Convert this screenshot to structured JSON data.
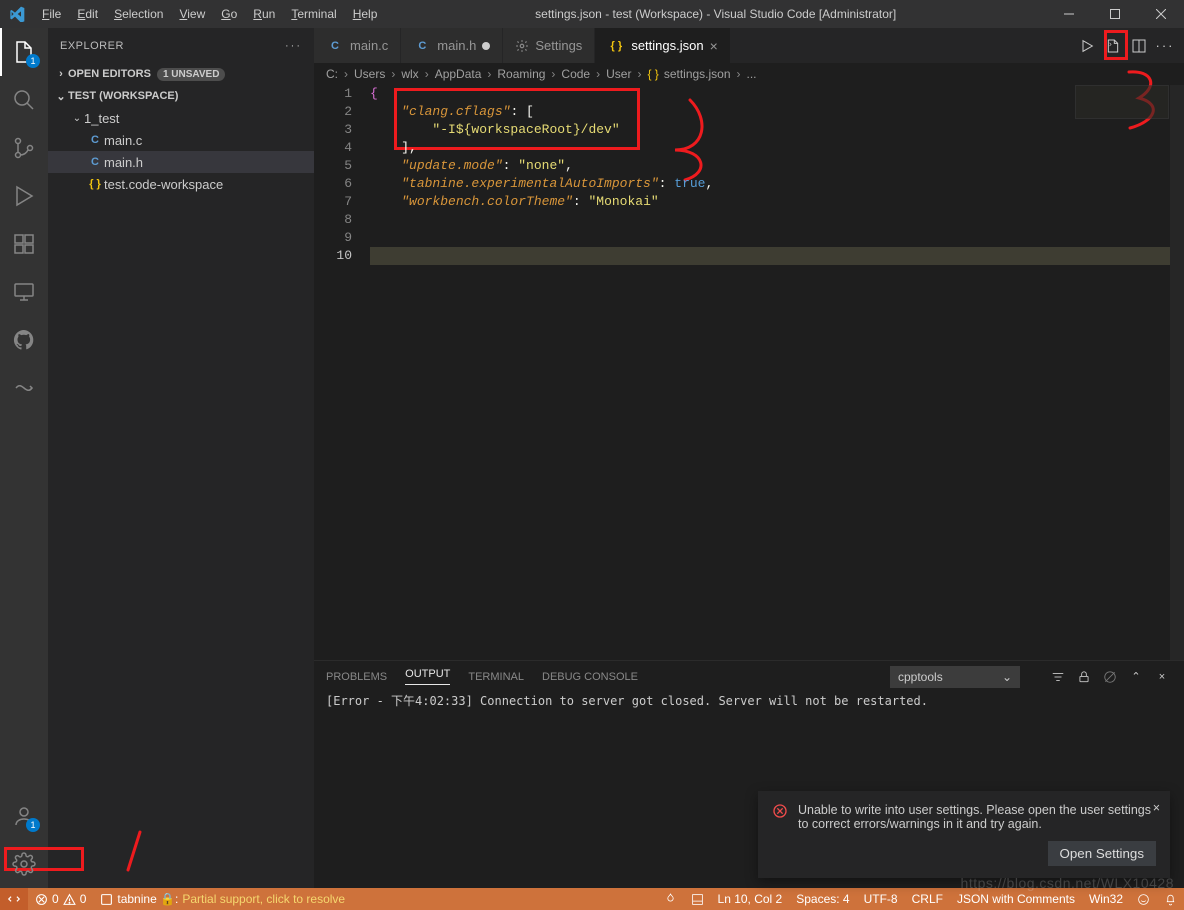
{
  "window_title": "settings.json - test (Workspace) - Visual Studio Code [Administrator]",
  "menu": [
    "File",
    "Edit",
    "Selection",
    "View",
    "Go",
    "Run",
    "Terminal",
    "Help"
  ],
  "explorer": {
    "title": "EXPLORER",
    "open_editors": {
      "label": "OPEN EDITORS",
      "badge": "1 UNSAVED"
    },
    "workspace": {
      "label": "TEST (WORKSPACE)"
    },
    "folder": {
      "name": "1_test"
    },
    "files": {
      "main_c": "main.c",
      "main_h": "main.h",
      "ws": "test.code-workspace"
    },
    "file_lang_c": "C",
    "file_lang_json": "{ }"
  },
  "tabs": {
    "main_c": "main.c",
    "main_h": "main.h",
    "settings": "Settings",
    "settings_json": "settings.json"
  },
  "breadcrumb": {
    "parts": [
      "C:",
      "Users",
      "wlx",
      "AppData",
      "Roaming",
      "Code",
      "User"
    ],
    "file": "settings.json",
    "dots": "..."
  },
  "code": {
    "l1": "{",
    "l2a": "\"clang.cflags\"",
    "l2b": ": [",
    "l3": "\"-I${workspaceRoot}/dev\"",
    "l4": "],",
    "l5a": "\"update.mode\"",
    "l5b": ": ",
    "l5c": "\"none\"",
    "l5d": ",",
    "l6a": "\"tabnine.experimentalAutoImports\"",
    "l6b": ": ",
    "l6c": "true",
    "l6d": ",",
    "l7a": "\"workbench.colorTheme\"",
    "l7b": ": ",
    "l7c": "\"Monokai\"",
    "l10": "}"
  },
  "panel": {
    "tabs": {
      "problems": "PROBLEMS",
      "output": "OUTPUT",
      "terminal": "TERMINAL",
      "debug": "DEBUG CONSOLE"
    },
    "select": "cpptools",
    "output_line": "[Error - 下午4:02:33] Connection to server got closed. Server will not be restarted."
  },
  "status": {
    "remote": "✕",
    "errors": "0",
    "warnings": "0",
    "tabnine": "tabnine 🔒:",
    "tabnine_status": "Partial support, click to resolve",
    "prettier": "",
    "line_col": "Ln 10, Col 2",
    "spaces": "Spaces: 4",
    "encoding": "UTF-8",
    "eol": "CRLF",
    "language": "JSON with Comments",
    "os": "Win32",
    "feedback": "",
    "bell": ""
  },
  "toast": {
    "message": "Unable to write into user settings. Please open the user settings to correct errors/warnings in it and try again.",
    "button": "Open Settings"
  },
  "badges": {
    "explorer": "1",
    "accounts": "1"
  },
  "watermark": "https://blog.csdn.net/WLX10428"
}
